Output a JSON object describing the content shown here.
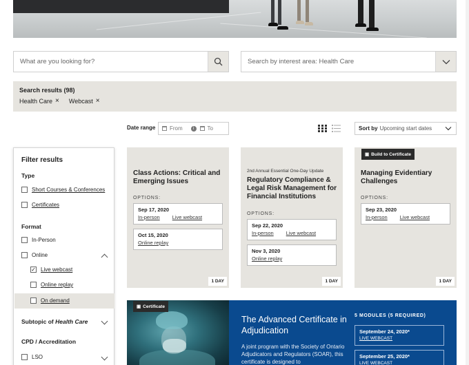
{
  "search": {
    "keyword_placeholder": "What are you looking for?",
    "interest_placeholder": "Search by interest area: Health Care"
  },
  "results": {
    "title": "Search results (98)",
    "chips": [
      "Health Care",
      "Webcast"
    ],
    "chip_remove": "×"
  },
  "toolbar": {
    "date_range_label": "Date range",
    "from_placeholder": "From",
    "to_placeholder": "To",
    "info": "i",
    "sort_label": "Sort by",
    "sort_value": "Upcoming start dates"
  },
  "filters": {
    "title": "Filter results",
    "type": {
      "heading": "Type",
      "options": [
        {
          "label": "Short Courses & Conferences",
          "checked": false
        },
        {
          "label": "Certificates",
          "checked": false
        }
      ]
    },
    "format": {
      "heading": "Format",
      "in_person": {
        "label": "In-Person",
        "checked": false
      },
      "online": {
        "label": "Online",
        "checked": false
      },
      "online_options": [
        {
          "label": "Live webcast",
          "checked": true
        },
        {
          "label": "Online replay",
          "checked": false
        },
        {
          "label": "On demand",
          "checked": false
        }
      ]
    },
    "subtopic": {
      "prefix": "Subtopic of",
      "topic": "Health Care"
    },
    "cpd": {
      "heading": "CPD / Accreditation",
      "options": [
        {
          "label": "LSO",
          "checked": false
        }
      ]
    }
  },
  "cards": [
    {
      "badge": "",
      "pretitle": "",
      "title": "Class Actions: Critical and Emerging Issues",
      "options_label": "OPTIONS:",
      "options": [
        {
          "date": "Sep 17, 2020",
          "links": [
            "In-person",
            "Live webcast"
          ]
        },
        {
          "date": "Oct 15, 2020",
          "links": [
            "Online replay"
          ]
        }
      ],
      "duration": "1 DAY"
    },
    {
      "badge": "",
      "pretitle": "2nd Annual Essential One-Day Update",
      "title": "Regulatory Compliance & Legal Risk Management for Financial Institutions",
      "options_label": "OPTIONS:",
      "options": [
        {
          "date": "Sep 22, 2020",
          "links": [
            "In-person",
            "Live webcast"
          ]
        },
        {
          "date": "Nov 3, 2020",
          "links": [
            "Online replay"
          ]
        }
      ],
      "duration": "1 DAY"
    },
    {
      "badge": "Build to Certificate",
      "pretitle": "",
      "title": "Managing Evidentiary Challenges",
      "options_label": "OPTIONS:",
      "options": [
        {
          "date": "Sep 23, 2020",
          "links": [
            "In-person",
            "Live webcast"
          ]
        }
      ],
      "duration": "1 DAY"
    }
  ],
  "feature": {
    "badge": "Certificate",
    "title": "The Advanced Certificate in Adjudication",
    "description": "A joint program with the Society of Ontario Adjudicators and Regulators (SOAR), this certificate is designed to",
    "modules_label": "5 MODULES (5 REQUIRED)",
    "modules": [
      {
        "date": "September 24, 2020*",
        "type": "LIVE WEBCAST"
      },
      {
        "date": "September 25, 2020*",
        "type": "LIVE WEBCAST"
      }
    ]
  },
  "colors": {
    "feature_blue": "#0a4a8f",
    "panel_beige": "#e6e4df"
  }
}
